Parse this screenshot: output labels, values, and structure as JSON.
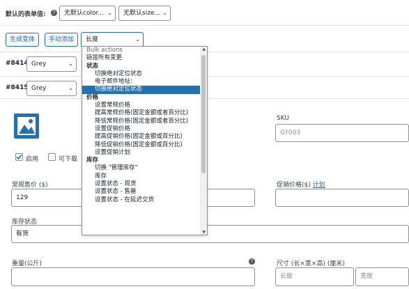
{
  "toolbar": {
    "default_values_label": "默认的表单值:",
    "help_icon": "?",
    "color_select": "无默认color...",
    "size_select": "无默认size...",
    "generate_button": "生成变体",
    "manual_add_button": "手动添加",
    "bulk_select_value": "长度"
  },
  "variations": [
    {
      "id": "#8414",
      "attribute": "Grey"
    },
    {
      "id": "#8415",
      "attribute": "Grey"
    }
  ],
  "dropdown": {
    "header": "Bulk actions",
    "first": "链接所有变更",
    "groups": [
      {
        "label": "状态",
        "options": [
          "切换绝对定位状态",
          "电子邮件地址:",
          "切换绝对定位状态"
        ],
        "highlighted_index": 2
      },
      {
        "label": "价格",
        "options": [
          "设置常规价格",
          "提高常规价格(固定金额或者百分比)",
          "降低常规价格(固定金额或者百分比)",
          "设置促销价格",
          "提高促销价格(固定金额或百分比)",
          "降低促销价格(固定金额或百分比)",
          "设置促销计划"
        ]
      },
      {
        "label": "库存",
        "options": [
          "切换 \"管理库存\"",
          "库存",
          "设置状态 - 现货",
          "设置状态 - 售罄",
          "设置状态 - 在延迟交货"
        ]
      }
    ]
  },
  "detail": {
    "sku_label": "SKU",
    "sku_placeholder": "GY003",
    "enabled_label": "启用",
    "downloadable_label": "可下载",
    "regular_price_label": "常规售价 ($)",
    "regular_price_value": "129",
    "sale_price_label": "促销价格($)",
    "schedule_link": "计划",
    "stock_status_label": "库存状态",
    "stock_status_value": "有货",
    "weight_label": "重量(公斤)",
    "dimensions_label": "尺寸 (长×宽×高) (厘米)",
    "length_placeholder": "长度",
    "width_placeholder": "宽度"
  },
  "colors": {
    "accent": "#2271b1",
    "highlight": "#2271b1"
  }
}
